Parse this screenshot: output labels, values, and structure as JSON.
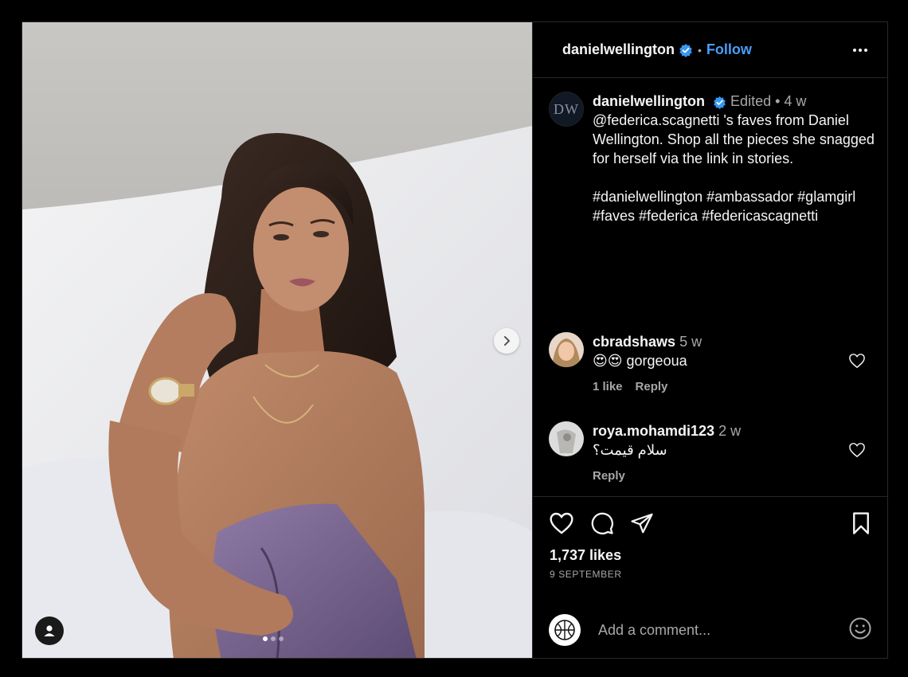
{
  "post": {
    "author": "danielwellington",
    "follow_label": "Follow",
    "separator": "•",
    "avatar_initials": "DW",
    "caption_meta": "Edited • 4 w",
    "caption_text": "@federica.scagnetti 's faves from Daniel Wellington. Shop all the pieces she snagged for herself via the link in stories.\n⠀⠀⠀⠀⠀⠀⠀⠀⠀⠀⠀⠀\n#danielwellington #ambassador #glamgirl #faves #federica #federicascagnetti",
    "media_slide": 1,
    "media_slide_count": 3
  },
  "comments": [
    {
      "user": "cbradshaws",
      "time": "5 w",
      "text": "😍😍 gorgeoua",
      "likes_label": "1 like",
      "reply_label": "Reply"
    },
    {
      "user": "roya.mohamdi123",
      "time": "2 w",
      "text": "سلام قیمت؟",
      "reply_label": "Reply"
    }
  ],
  "stats": {
    "likes": "1,737 likes",
    "date": "9 SEPTEMBER"
  },
  "composer": {
    "placeholder": "Add a comment..."
  },
  "icons": {
    "like": "heart-icon",
    "comment": "comment-bubble-icon",
    "share": "paper-plane-icon",
    "save": "bookmark-icon",
    "more": "more-options-icon",
    "next": "chevron-right-icon",
    "tags": "user-tag-icon",
    "emoji": "smiley-icon"
  },
  "colors": {
    "background": "#000000",
    "accent": "#4a9df8",
    "muted_text": "#a8a8a8",
    "verified_badge": "#3897f0"
  }
}
